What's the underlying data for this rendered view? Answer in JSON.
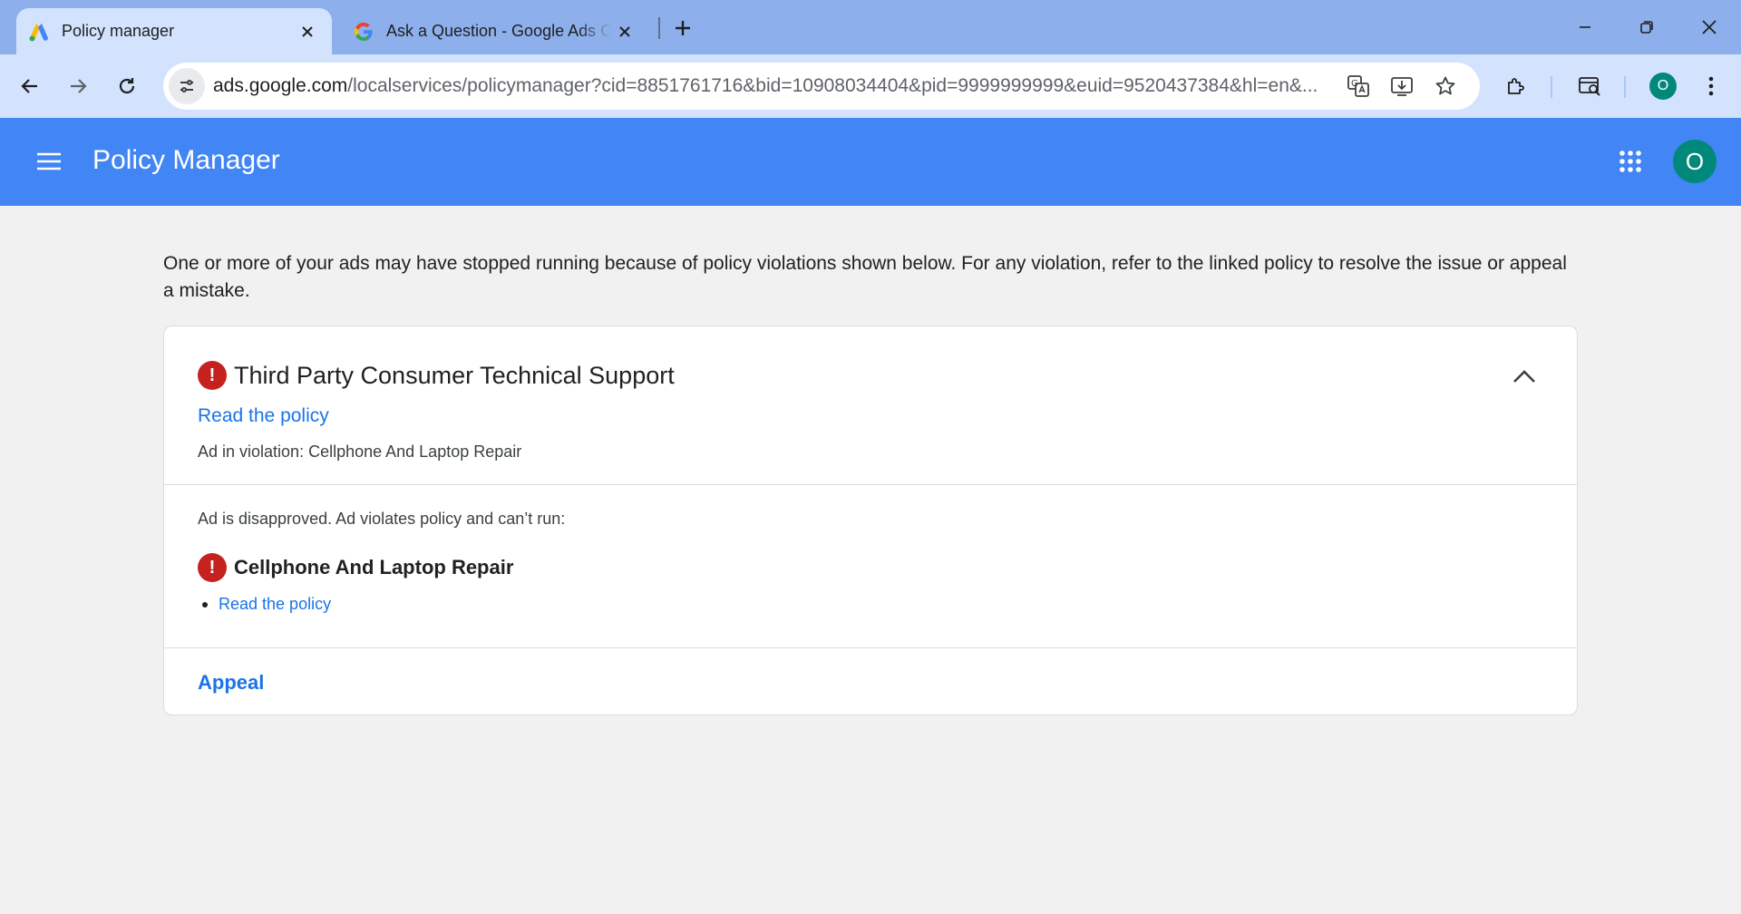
{
  "browser": {
    "tabs": [
      {
        "title": "Policy manager",
        "favicon": "google-ads-logo-icon",
        "active": true
      },
      {
        "title": "Ask a Question - Google Ads Community",
        "favicon": "google-g-logo-icon",
        "active": false
      }
    ],
    "address": {
      "host": "ads.google.com",
      "path": "/localservices/policymanager?cid=8851761716&bid=10908034404&pid=9999999999&euid=9520437384&hl=en&..."
    },
    "profile_initial": "O"
  },
  "app": {
    "title": "Policy Manager",
    "avatar_initial": "O",
    "accent": "#4285f4"
  },
  "content": {
    "intro": "One or more of your ads may have stopped running because of policy violations shown below. For any violation, refer to the linked policy to resolve the issue or appeal a mistake.",
    "violation": {
      "policy_title": "Third Party Consumer Technical Support",
      "read_policy_label": "Read the policy",
      "ad_in_violation": "Ad in violation: Cellphone And Laptop Repair",
      "status_text": "Ad is disapproved. Ad violates policy and can’t run:",
      "ad_name": "Cellphone And Laptop Repair",
      "ad_read_policy_label": "Read the policy",
      "appeal_label": "Appeal",
      "error_color": "#c5221f"
    }
  }
}
